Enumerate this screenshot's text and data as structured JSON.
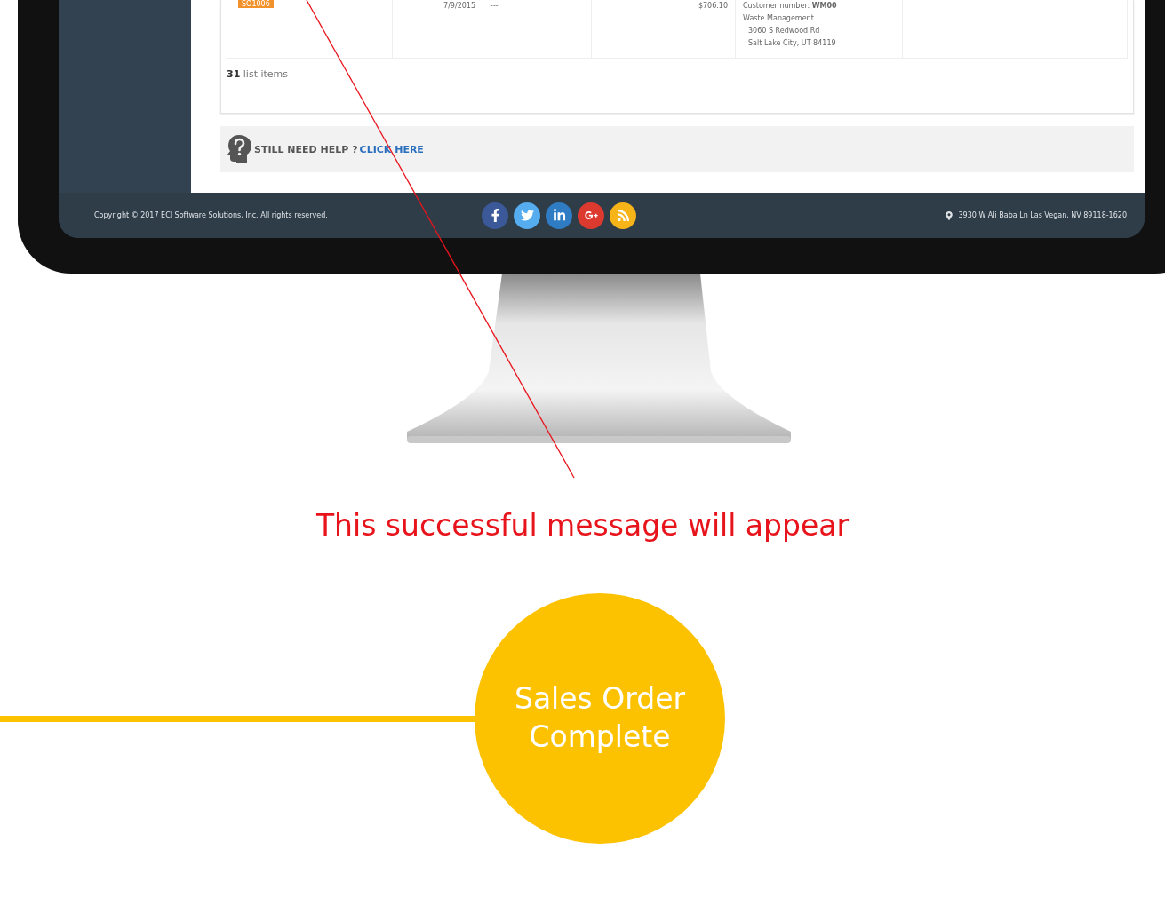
{
  "order_row": {
    "order_badge": "SO1006",
    "date": "7/9/2015",
    "column_3": "---",
    "amount": "$706.10",
    "customer_number": "Customer number: **WM00**",
    "customer_name": "Waste Management",
    "address_line_1": "3060 S Redwood Rd",
    "address_line_2": "Salt Lake City, UT 84119"
  },
  "list_count": {
    "count": "31",
    "label": "list items"
  },
  "help_banner": {
    "text": "STILL NEED HELP ?",
    "link": "CLICK HERE"
  },
  "footer": {
    "copyright": "Copyright © 2017 ECI Software Solutions, Inc. All rights reserved.",
    "social_links": [
      {
        "kind": "facebook",
        "color": "#3b5998"
      },
      {
        "kind": "twitter",
        "color": "#55acee"
      },
      {
        "kind": "linkedin",
        "color": "#2f7bc4"
      },
      {
        "kind": "googleplus",
        "color": "#dd3a2f"
      },
      {
        "kind": "rss",
        "color": "#f6b418"
      }
    ],
    "address": "3930 W Ali Baba Ln Las Vegan, NV 89118-1620"
  },
  "annotation": {
    "message": "This successful message will appear"
  },
  "step": {
    "label": "Sales Order Complete"
  }
}
